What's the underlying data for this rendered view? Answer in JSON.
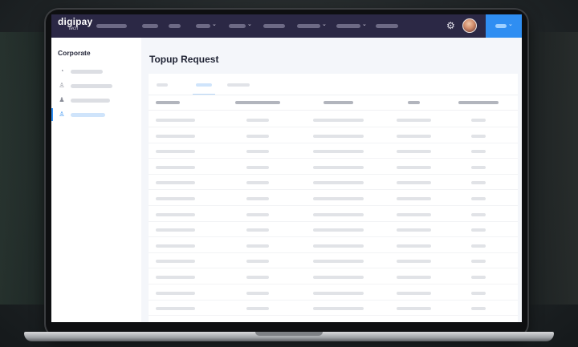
{
  "app": {
    "logo_text": "digipay",
    "logo_sub": "tech"
  },
  "navbar": {
    "items": [
      {
        "name": "nav-item-1",
        "has_chevron": false
      },
      {
        "name": "nav-item-2",
        "has_chevron": false
      },
      {
        "name": "nav-item-3",
        "has_chevron": false
      },
      {
        "name": "nav-item-4",
        "has_chevron": true
      },
      {
        "name": "nav-item-5",
        "has_chevron": true
      },
      {
        "name": "nav-item-6",
        "has_chevron": false
      },
      {
        "name": "nav-item-7",
        "has_chevron": true
      },
      {
        "name": "nav-item-8",
        "has_chevron": true
      },
      {
        "name": "nav-item-9",
        "has_chevron": false
      }
    ],
    "settings_icon": "gear-icon",
    "avatar_icon": "avatar",
    "accent_color": "#2f8ef2",
    "bar_color": "#2b2845"
  },
  "sidebar": {
    "title": "Corporate",
    "items": [
      {
        "icon": "pie-chart-icon",
        "active": false
      },
      {
        "icon": "user-tree-icon",
        "active": false
      },
      {
        "icon": "group-icon",
        "active": false
      },
      {
        "icon": "user-tree-icon",
        "active": true
      }
    ]
  },
  "main": {
    "page_title": "Topup Request",
    "tabs": [
      {
        "active": false
      },
      {
        "active": true
      },
      {
        "active": false
      }
    ],
    "columns": 5,
    "rows": 13
  }
}
